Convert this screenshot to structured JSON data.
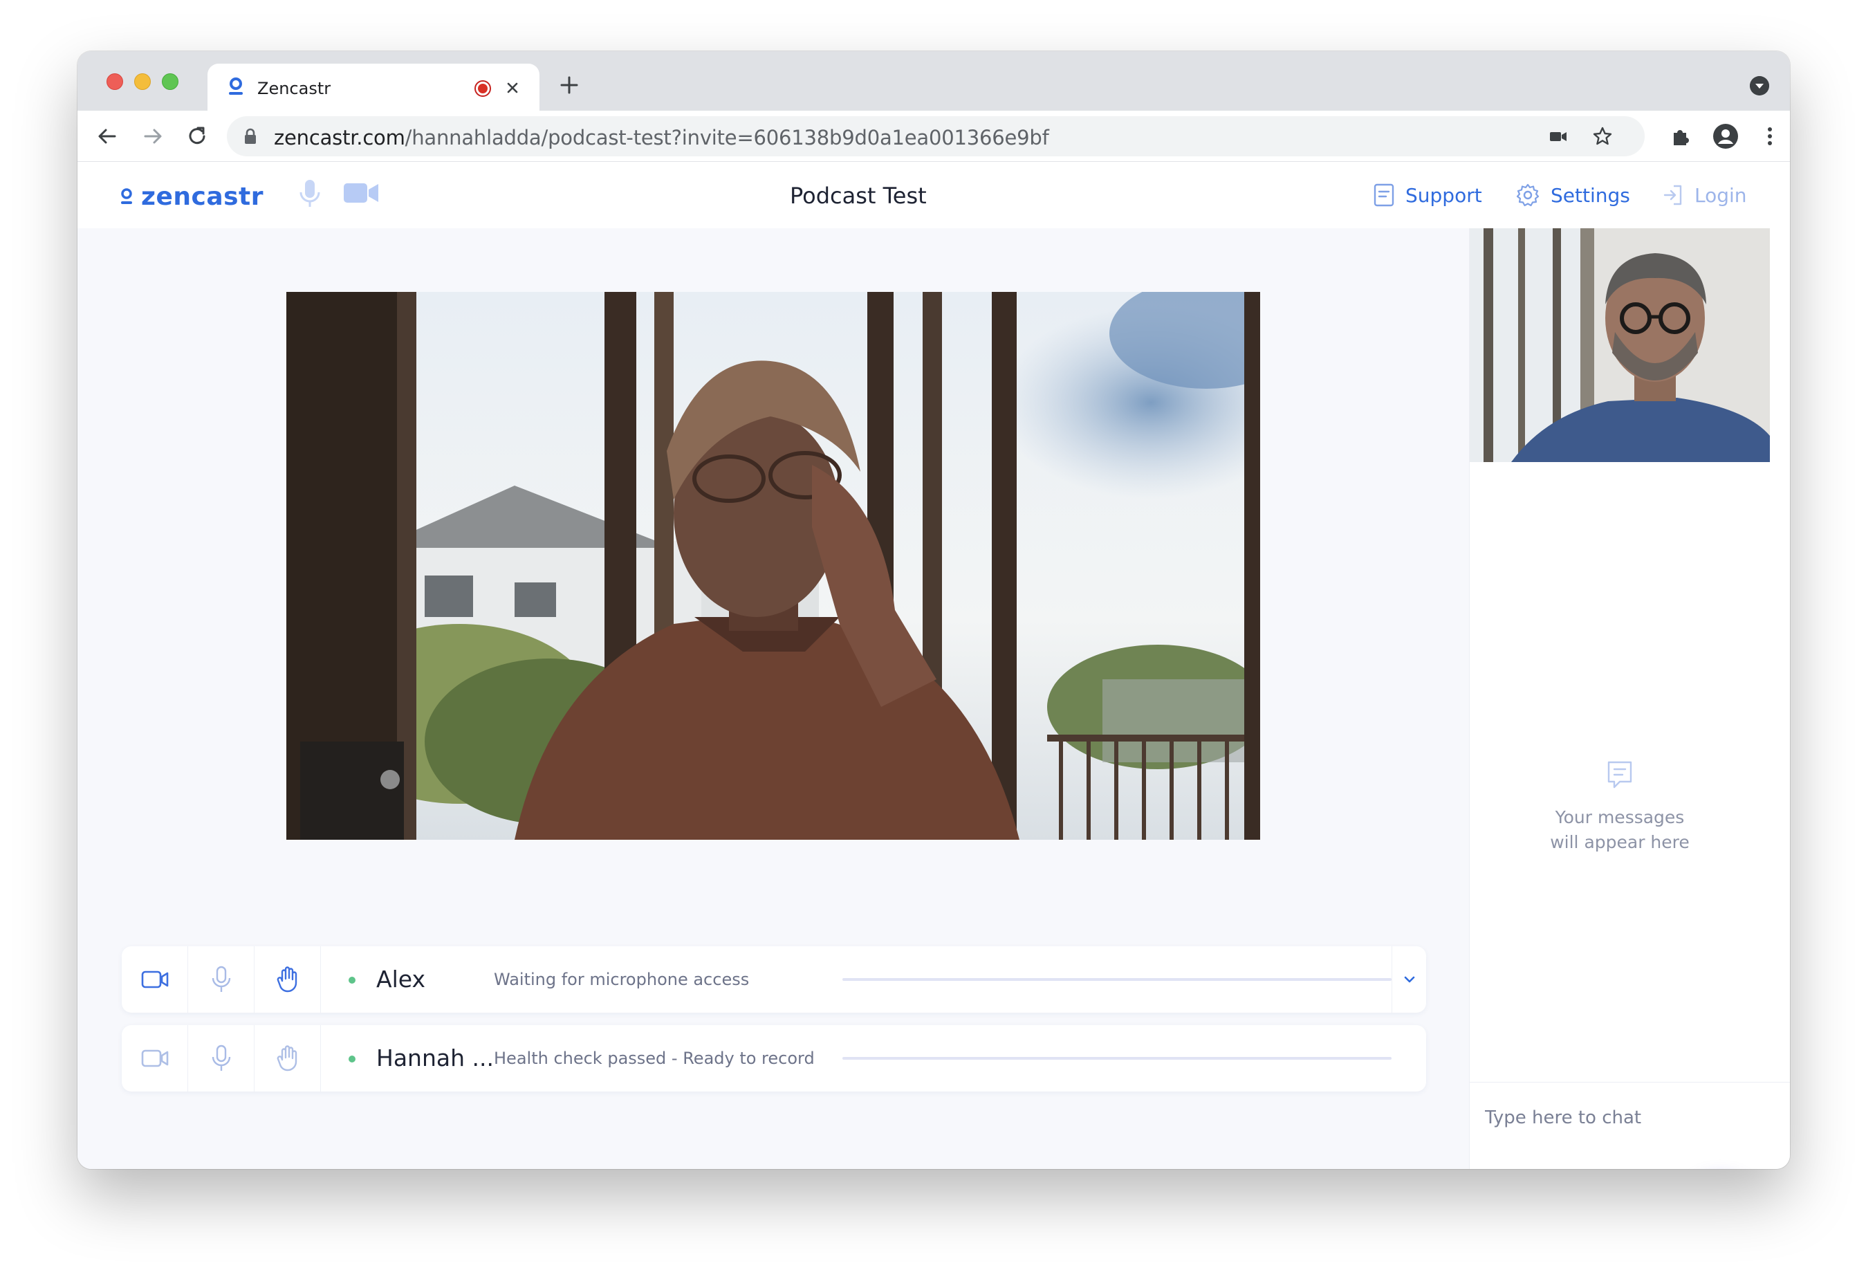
{
  "browser": {
    "tab_title": "Zencastr",
    "url_host": "zencastr.com",
    "url_path": "/hannahladda/podcast-test?invite=606138b9d0a1ea001366e9bf"
  },
  "app": {
    "logo": "zencastr",
    "page_title": "Podcast Test",
    "nav": {
      "support": "Support",
      "settings": "Settings",
      "login": "Login"
    }
  },
  "tracks": [
    {
      "name": "Alex",
      "status": "Waiting for microphone access"
    },
    {
      "name": "Hannah ...",
      "status": "Health check passed - Ready to record"
    }
  ],
  "chat": {
    "empty_line1": "Your messages",
    "empty_line2": "will appear here",
    "placeholder": "Type here to chat"
  },
  "colors": {
    "brand": "#2f6bde",
    "launcher": "#8f86ec",
    "status_ok": "#5ec48a"
  }
}
